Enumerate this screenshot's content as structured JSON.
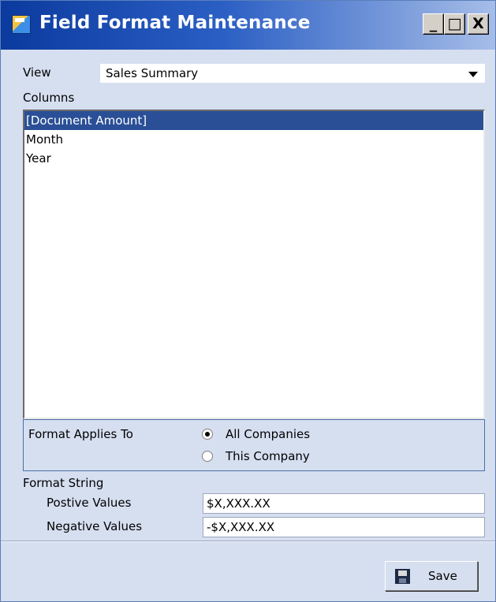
{
  "window": {
    "title": "Field Format Maintenance"
  },
  "titlebar_buttons": {
    "minimize": "_",
    "maximize": "□",
    "close": "X"
  },
  "view": {
    "label": "View",
    "selected": "Sales Summary"
  },
  "columns": {
    "label": "Columns",
    "items": [
      "[Document Amount]",
      "Month",
      "Year"
    ],
    "selected_index": 0
  },
  "format_applies_to": {
    "label": "Format Applies To",
    "options": [
      "All Companies",
      "This Company"
    ],
    "selected": "All Companies"
  },
  "format_string": {
    "label": "Format String",
    "positive_label": "Postive Values",
    "positive_value": "$X,XXX.XX",
    "negative_label": "Negative Values",
    "negative_value": "-$X,XXX.XX"
  },
  "save_button": {
    "label": "Save",
    "icon": "floppy-disk-icon"
  },
  "colors": {
    "selection": "#2a4f96",
    "client_bg": "#d6dff0",
    "title_start": "#0b3a9e"
  }
}
